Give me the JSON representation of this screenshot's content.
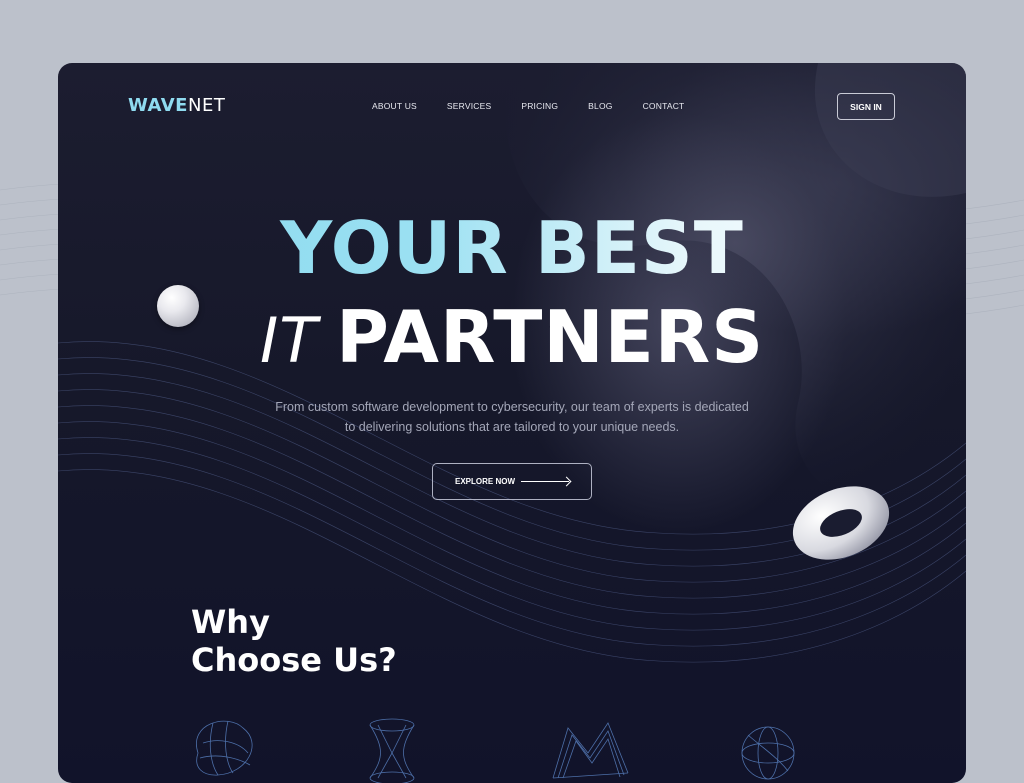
{
  "brand": {
    "logo_accent": "WAVE",
    "logo_rest": "NET"
  },
  "nav": {
    "items": [
      "ABOUT US",
      "SERVICES",
      "PRICING",
      "BLOG",
      "CONTACT"
    ],
    "signin_label": "SIGN IN"
  },
  "hero": {
    "title_line1": "YOUR BEST",
    "title_line2_italic": "IT",
    "title_line2": "PARTNERS",
    "subtitle_line1": "From custom software development to cybersecurity, our team of experts is dedicated",
    "subtitle_line2": "to delivering solutions that are tailored to your unique needs.",
    "cta_label": "EXPLORE NOW"
  },
  "why": {
    "line1": "Why",
    "line2": "Choose Us?"
  },
  "icons": [
    "wireframe-blob-icon",
    "wireframe-hourglass-icon",
    "wireframe-wave-icon",
    "wireframe-sphere-icon"
  ],
  "colors": {
    "background": "#16182a",
    "accent": "#86d8ee",
    "page_bg": "#bcc1cb"
  }
}
